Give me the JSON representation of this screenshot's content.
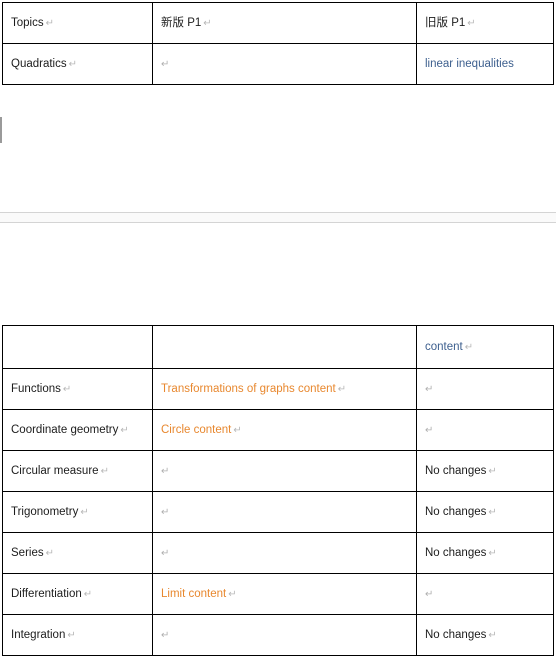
{
  "document": {
    "type": "word-processor-document",
    "paragraph_mark": "↵",
    "colors": {
      "text": "#1c1c1c",
      "blue_text": "#3d5f8e",
      "orange_text": "#e8882f",
      "pilcrow": "#b8b8b8",
      "table_border": "#000000",
      "page_break_band": "#fafafa",
      "page_break_line": "#d4d4d4"
    }
  },
  "table_one": {
    "name": "syllabus-comparison-table-top",
    "columns": [
      "Topics",
      "新版 P1",
      "旧版 P1"
    ],
    "header": [
      {
        "text": "Topics",
        "color": "plain",
        "mark": true
      },
      {
        "text": "新版 P1",
        "color": "plain",
        "mark": true
      },
      {
        "text": "旧版 P1",
        "color": "plain",
        "mark": true
      }
    ],
    "rows": [
      [
        {
          "text": "Quadratics",
          "color": "plain",
          "mark": true
        },
        {
          "text": "",
          "color": "plain",
          "mark": true
        },
        {
          "text": "linear inequalities",
          "color": "blue",
          "mark": false
        }
      ]
    ]
  },
  "table_two": {
    "name": "syllabus-comparison-table-bottom",
    "rows": [
      [
        {
          "text": "",
          "color": "plain",
          "mark": false
        },
        {
          "text": "",
          "color": "plain",
          "mark": false
        },
        {
          "text": "content",
          "color": "blue",
          "mark": true
        }
      ],
      [
        {
          "text": "Functions",
          "color": "plain",
          "mark": true
        },
        {
          "text": "Transformations of graphs content",
          "color": "orange",
          "mark": true
        },
        {
          "text": "",
          "color": "plain",
          "mark": true
        }
      ],
      [
        {
          "text": "Coordinate geometry",
          "color": "plain",
          "mark": true
        },
        {
          "text": "Circle content",
          "color": "orange",
          "mark": true
        },
        {
          "text": "",
          "color": "plain",
          "mark": true
        }
      ],
      [
        {
          "text": "Circular measure",
          "color": "plain",
          "mark": true
        },
        {
          "text": "",
          "color": "plain",
          "mark": true
        },
        {
          "text": "No changes",
          "color": "plain",
          "mark": true
        }
      ],
      [
        {
          "text": "Trigonometry",
          "color": "plain",
          "mark": true
        },
        {
          "text": "",
          "color": "plain",
          "mark": true
        },
        {
          "text": "No changes",
          "color": "plain",
          "mark": true
        }
      ],
      [
        {
          "text": "Series",
          "color": "plain",
          "mark": true
        },
        {
          "text": "",
          "color": "plain",
          "mark": true
        },
        {
          "text": "No changes",
          "color": "plain",
          "mark": true
        }
      ],
      [
        {
          "text": "Differentiation",
          "color": "plain",
          "mark": true
        },
        {
          "text": "Limit content",
          "color": "orange",
          "mark": true
        },
        {
          "text": "",
          "color": "plain",
          "mark": true
        }
      ],
      [
        {
          "text": "Integration",
          "color": "plain",
          "mark": true
        },
        {
          "text": "",
          "color": "plain",
          "mark": true
        },
        {
          "text": "No changes",
          "color": "plain",
          "mark": true
        }
      ]
    ]
  }
}
